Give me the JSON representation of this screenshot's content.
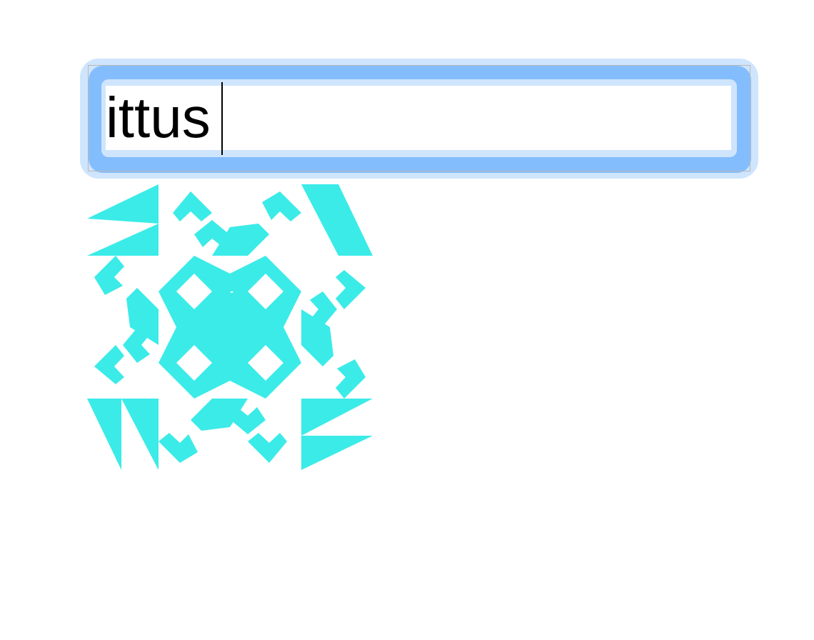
{
  "input": {
    "value": "ittus",
    "placeholder": ""
  },
  "avatar": {
    "kind": "identicon-icon",
    "color": "#3bebe8"
  },
  "colors": {
    "focus_ring": "#84bdfd",
    "focus_halo": "#cfe5fd",
    "background": "#ffffff"
  }
}
